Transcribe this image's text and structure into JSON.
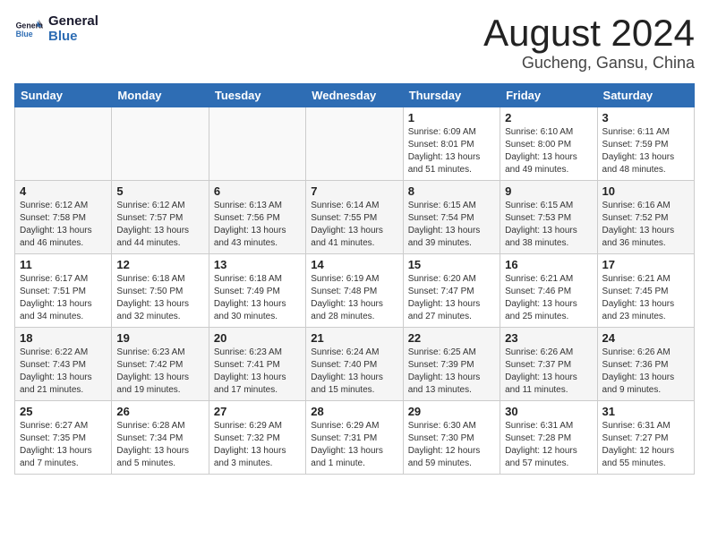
{
  "header": {
    "logo_general": "General",
    "logo_blue": "Blue",
    "month": "August 2024",
    "location": "Gucheng, Gansu, China"
  },
  "weekdays": [
    "Sunday",
    "Monday",
    "Tuesday",
    "Wednesday",
    "Thursday",
    "Friday",
    "Saturday"
  ],
  "weeks": [
    [
      {
        "day": "",
        "info": ""
      },
      {
        "day": "",
        "info": ""
      },
      {
        "day": "",
        "info": ""
      },
      {
        "day": "",
        "info": ""
      },
      {
        "day": "1",
        "info": "Sunrise: 6:09 AM\nSunset: 8:01 PM\nDaylight: 13 hours\nand 51 minutes."
      },
      {
        "day": "2",
        "info": "Sunrise: 6:10 AM\nSunset: 8:00 PM\nDaylight: 13 hours\nand 49 minutes."
      },
      {
        "day": "3",
        "info": "Sunrise: 6:11 AM\nSunset: 7:59 PM\nDaylight: 13 hours\nand 48 minutes."
      }
    ],
    [
      {
        "day": "4",
        "info": "Sunrise: 6:12 AM\nSunset: 7:58 PM\nDaylight: 13 hours\nand 46 minutes."
      },
      {
        "day": "5",
        "info": "Sunrise: 6:12 AM\nSunset: 7:57 PM\nDaylight: 13 hours\nand 44 minutes."
      },
      {
        "day": "6",
        "info": "Sunrise: 6:13 AM\nSunset: 7:56 PM\nDaylight: 13 hours\nand 43 minutes."
      },
      {
        "day": "7",
        "info": "Sunrise: 6:14 AM\nSunset: 7:55 PM\nDaylight: 13 hours\nand 41 minutes."
      },
      {
        "day": "8",
        "info": "Sunrise: 6:15 AM\nSunset: 7:54 PM\nDaylight: 13 hours\nand 39 minutes."
      },
      {
        "day": "9",
        "info": "Sunrise: 6:15 AM\nSunset: 7:53 PM\nDaylight: 13 hours\nand 38 minutes."
      },
      {
        "day": "10",
        "info": "Sunrise: 6:16 AM\nSunset: 7:52 PM\nDaylight: 13 hours\nand 36 minutes."
      }
    ],
    [
      {
        "day": "11",
        "info": "Sunrise: 6:17 AM\nSunset: 7:51 PM\nDaylight: 13 hours\nand 34 minutes."
      },
      {
        "day": "12",
        "info": "Sunrise: 6:18 AM\nSunset: 7:50 PM\nDaylight: 13 hours\nand 32 minutes."
      },
      {
        "day": "13",
        "info": "Sunrise: 6:18 AM\nSunset: 7:49 PM\nDaylight: 13 hours\nand 30 minutes."
      },
      {
        "day": "14",
        "info": "Sunrise: 6:19 AM\nSunset: 7:48 PM\nDaylight: 13 hours\nand 28 minutes."
      },
      {
        "day": "15",
        "info": "Sunrise: 6:20 AM\nSunset: 7:47 PM\nDaylight: 13 hours\nand 27 minutes."
      },
      {
        "day": "16",
        "info": "Sunrise: 6:21 AM\nSunset: 7:46 PM\nDaylight: 13 hours\nand 25 minutes."
      },
      {
        "day": "17",
        "info": "Sunrise: 6:21 AM\nSunset: 7:45 PM\nDaylight: 13 hours\nand 23 minutes."
      }
    ],
    [
      {
        "day": "18",
        "info": "Sunrise: 6:22 AM\nSunset: 7:43 PM\nDaylight: 13 hours\nand 21 minutes."
      },
      {
        "day": "19",
        "info": "Sunrise: 6:23 AM\nSunset: 7:42 PM\nDaylight: 13 hours\nand 19 minutes."
      },
      {
        "day": "20",
        "info": "Sunrise: 6:23 AM\nSunset: 7:41 PM\nDaylight: 13 hours\nand 17 minutes."
      },
      {
        "day": "21",
        "info": "Sunrise: 6:24 AM\nSunset: 7:40 PM\nDaylight: 13 hours\nand 15 minutes."
      },
      {
        "day": "22",
        "info": "Sunrise: 6:25 AM\nSunset: 7:39 PM\nDaylight: 13 hours\nand 13 minutes."
      },
      {
        "day": "23",
        "info": "Sunrise: 6:26 AM\nSunset: 7:37 PM\nDaylight: 13 hours\nand 11 minutes."
      },
      {
        "day": "24",
        "info": "Sunrise: 6:26 AM\nSunset: 7:36 PM\nDaylight: 13 hours\nand 9 minutes."
      }
    ],
    [
      {
        "day": "25",
        "info": "Sunrise: 6:27 AM\nSunset: 7:35 PM\nDaylight: 13 hours\nand 7 minutes."
      },
      {
        "day": "26",
        "info": "Sunrise: 6:28 AM\nSunset: 7:34 PM\nDaylight: 13 hours\nand 5 minutes."
      },
      {
        "day": "27",
        "info": "Sunrise: 6:29 AM\nSunset: 7:32 PM\nDaylight: 13 hours\nand 3 minutes."
      },
      {
        "day": "28",
        "info": "Sunrise: 6:29 AM\nSunset: 7:31 PM\nDaylight: 13 hours\nand 1 minute."
      },
      {
        "day": "29",
        "info": "Sunrise: 6:30 AM\nSunset: 7:30 PM\nDaylight: 12 hours\nand 59 minutes."
      },
      {
        "day": "30",
        "info": "Sunrise: 6:31 AM\nSunset: 7:28 PM\nDaylight: 12 hours\nand 57 minutes."
      },
      {
        "day": "31",
        "info": "Sunrise: 6:31 AM\nSunset: 7:27 PM\nDaylight: 12 hours\nand 55 minutes."
      }
    ]
  ]
}
